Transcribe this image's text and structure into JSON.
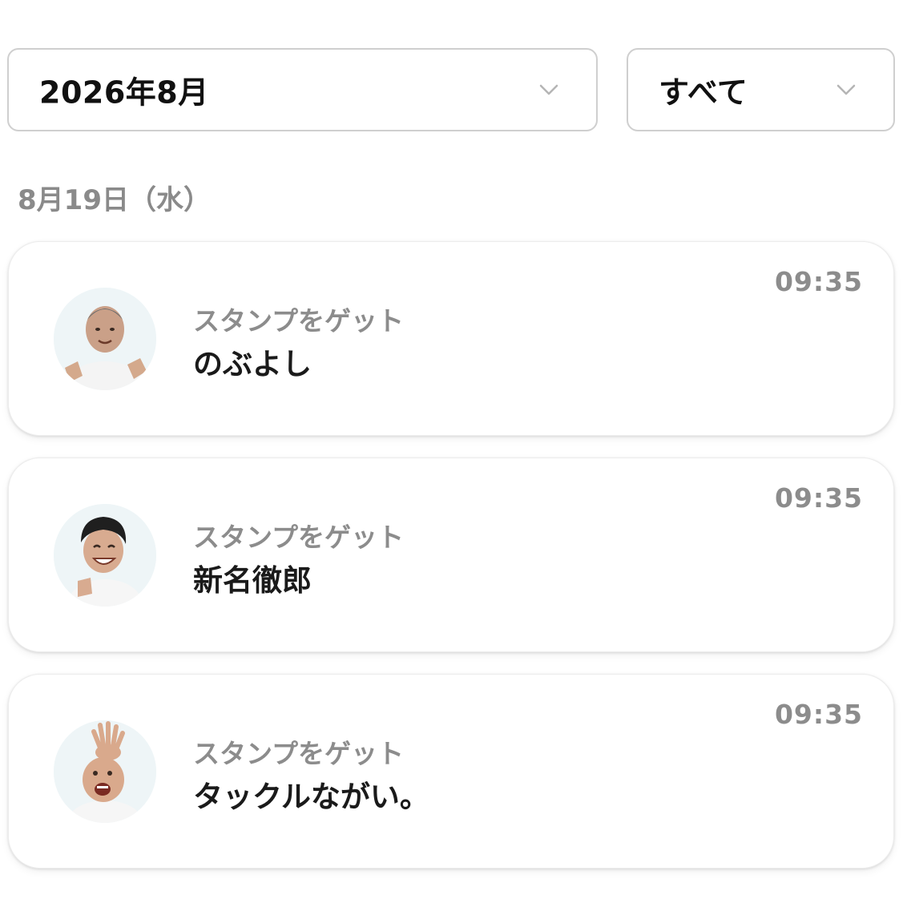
{
  "filters": {
    "month": {
      "value": "2026年8月",
      "icon": "chevron-down-icon"
    },
    "kind": {
      "value": "すべて",
      "icon": "chevron-down-icon"
    }
  },
  "date_heading": "8月19日（水）",
  "history": [
    {
      "label": "スタンプをゲット",
      "name": "のぶよし",
      "time": "09:35",
      "avatar": "avatar-photo"
    },
    {
      "label": "スタンプをゲット",
      "name": "新名徹郎",
      "time": "09:35",
      "avatar": "avatar-photo"
    },
    {
      "label": "スタンプをゲット",
      "name": "タックルながい。",
      "time": "09:35",
      "avatar": "avatar-photo"
    }
  ],
  "colors": {
    "muted_text": "#8c8c8c",
    "primary_text": "#1a1a1a",
    "border": "#cfcfcf"
  }
}
